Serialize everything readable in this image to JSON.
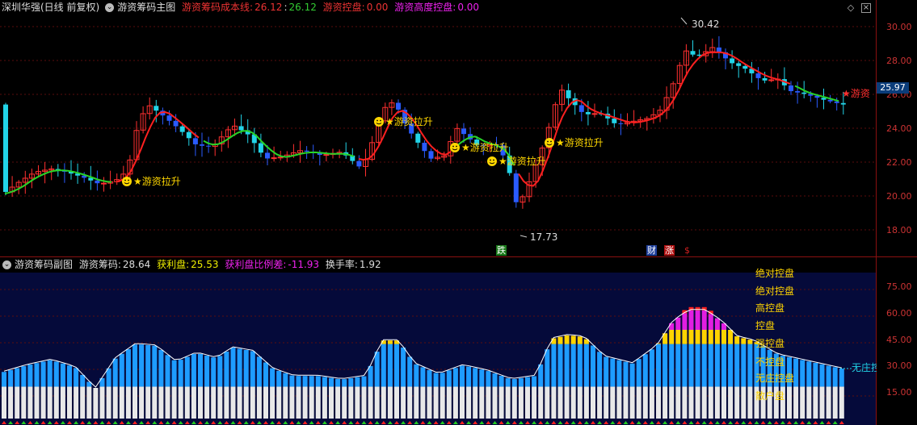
{
  "main": {
    "stock_name": "深圳华强(日线 前复权)",
    "indicator_name": "游资筹码主图",
    "cost_label": "游资筹码成本线:",
    "cost_value1": "26.12",
    "cost_sep": ":",
    "cost_value2": "26.12",
    "control_label": "游资控盘:",
    "control_value": "0.00",
    "high_control_label": "游资高度控盘:",
    "high_control_value": "0.00",
    "high_marker": "30.42",
    "low_marker": "17.73",
    "price_tag": "25.97",
    "star_label_right": "★游资",
    "signals": [
      {
        "text": "★游资拉升"
      },
      {
        "text": "★游资拉升"
      },
      {
        "text": "★游资拉升"
      },
      {
        "text": "★游资拉升"
      },
      {
        "text": "★游资拉升"
      }
    ],
    "events": [
      {
        "text": "跌",
        "color": "#1a7a1a"
      },
      {
        "text": "财",
        "color": "#1f3f9a"
      },
      {
        "text": "涨",
        "color": "#b01010"
      },
      {
        "text": "$",
        "color": "#d02020"
      }
    ],
    "y_ticks": [
      "30.00",
      "28.00",
      "26.00",
      "24.00",
      "22.00",
      "20.00",
      "18.00"
    ]
  },
  "sub": {
    "indicator_name": "游资筹码副图",
    "chip_label": "游资筹码:",
    "chip_value": "28.64",
    "profit_label": "获利盘:",
    "profit_value": "25.53",
    "ratio_label": "获利盘比例差:",
    "ratio_value": "-11.93",
    "turnover_label": "换手率:",
    "turnover_value": "1.92",
    "legend": [
      "绝对控盘",
      "绝对控盘",
      "高控盘",
      "控盘",
      "强控盘",
      "不控盘",
      "无庄控盘",
      "散户盘"
    ],
    "right_label": "无庄控",
    "y_ticks": [
      "75.00",
      "60.00",
      "45.00",
      "30.00",
      "15.00"
    ]
  }
}
